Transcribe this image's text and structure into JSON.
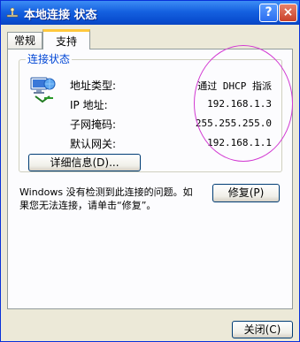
{
  "window": {
    "title": "本地连接 状态",
    "help_button": "?",
    "close_button": "×"
  },
  "tabs": [
    {
      "label": "常规",
      "selected": false
    },
    {
      "label": "支持",
      "selected": true
    }
  ],
  "connection_status": {
    "group_title": "连接状态",
    "rows": [
      {
        "label": "地址类型:",
        "value": "通过 DHCP 指派"
      },
      {
        "label": "IP 地址:",
        "value": "192.168.1.3"
      },
      {
        "label": "子网掩码:",
        "value": "255.255.255.0"
      },
      {
        "label": "默认网关:",
        "value": "192.168.1.1"
      }
    ],
    "details_button": "详细信息(D)..."
  },
  "message": "Windows 没有检测到此连接的问题。如果您无法连接，请单击“修复”。",
  "repair_button": "修复(P)",
  "close_dialog_button": "关闭(C)",
  "colors": {
    "titlebar": "#0a4fd1",
    "group_title": "#0046d5",
    "highlight_circle": "#d23ad2"
  }
}
